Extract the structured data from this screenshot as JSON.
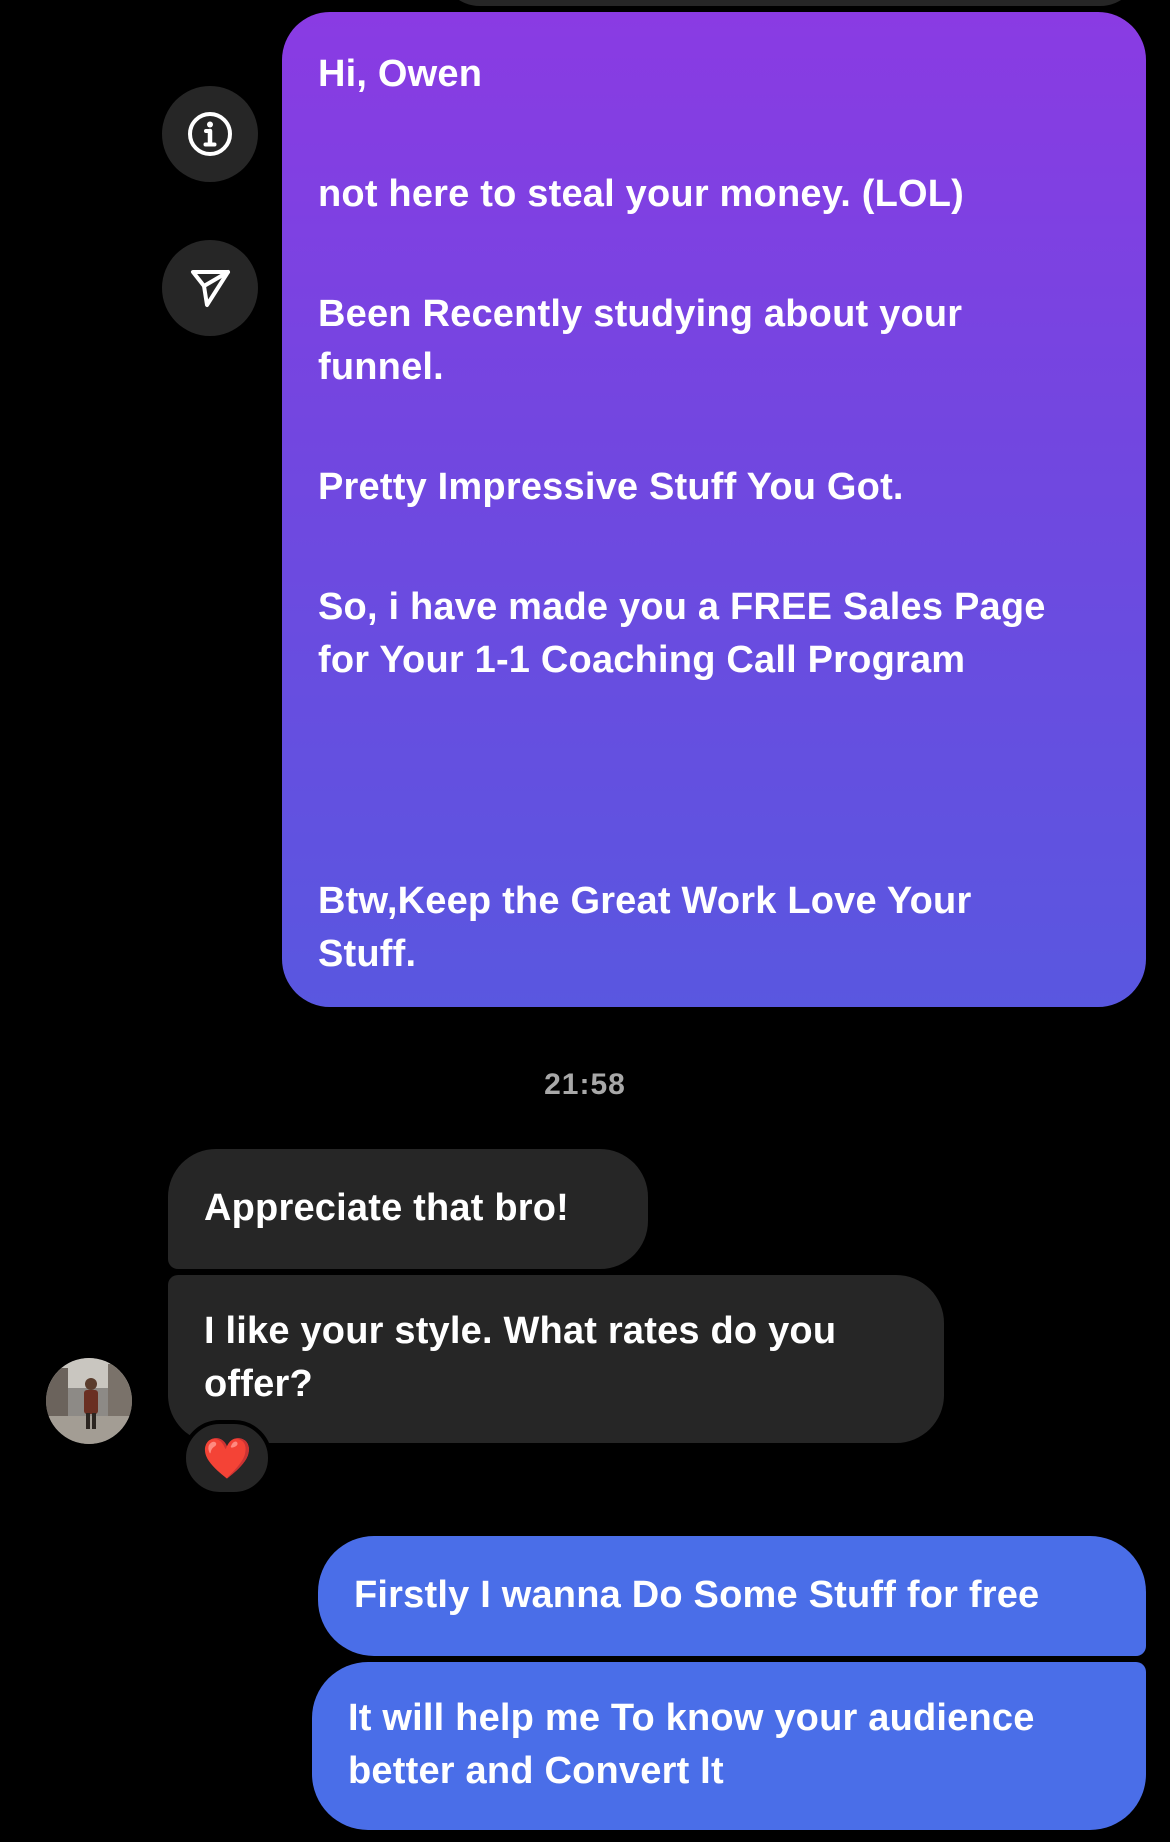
{
  "thread": {
    "sent_message": {
      "lines": [
        "Hi, Owen",
        "not here to steal your money. (LOL)",
        "Been Recently studying about your",
        "funnel.",
        "Pretty Impressive Stuff You Got.",
        "So, i have made you a FREE Sales Page",
        "for Your 1-1 Coaching Call Program",
        "Btw,Keep the Great Work Love Your",
        "Stuff."
      ]
    },
    "actions": {
      "info_icon": "info-icon",
      "share_icon": "send-icon"
    },
    "timestamp": "21:58",
    "received": [
      {
        "lines": [
          "Appreciate that bro!"
        ]
      },
      {
        "lines": [
          "I like your style. What rates do you",
          "offer?"
        ],
        "reaction": "❤️"
      }
    ],
    "replies": [
      {
        "lines": [
          "Firstly I wanna Do Some Stuff for free"
        ]
      },
      {
        "lines": [
          "It will help me To know your audience",
          "better and Convert It"
        ]
      }
    ]
  },
  "colors": {
    "background": "#000000",
    "incoming_bubble": "#262626",
    "outgoing_bubble": "#4a6ee8",
    "gradient_top": "#8a3be3",
    "gradient_bottom": "#5957e0",
    "timestamp": "#a8a8a8",
    "reaction_heart": "#e0243a"
  }
}
